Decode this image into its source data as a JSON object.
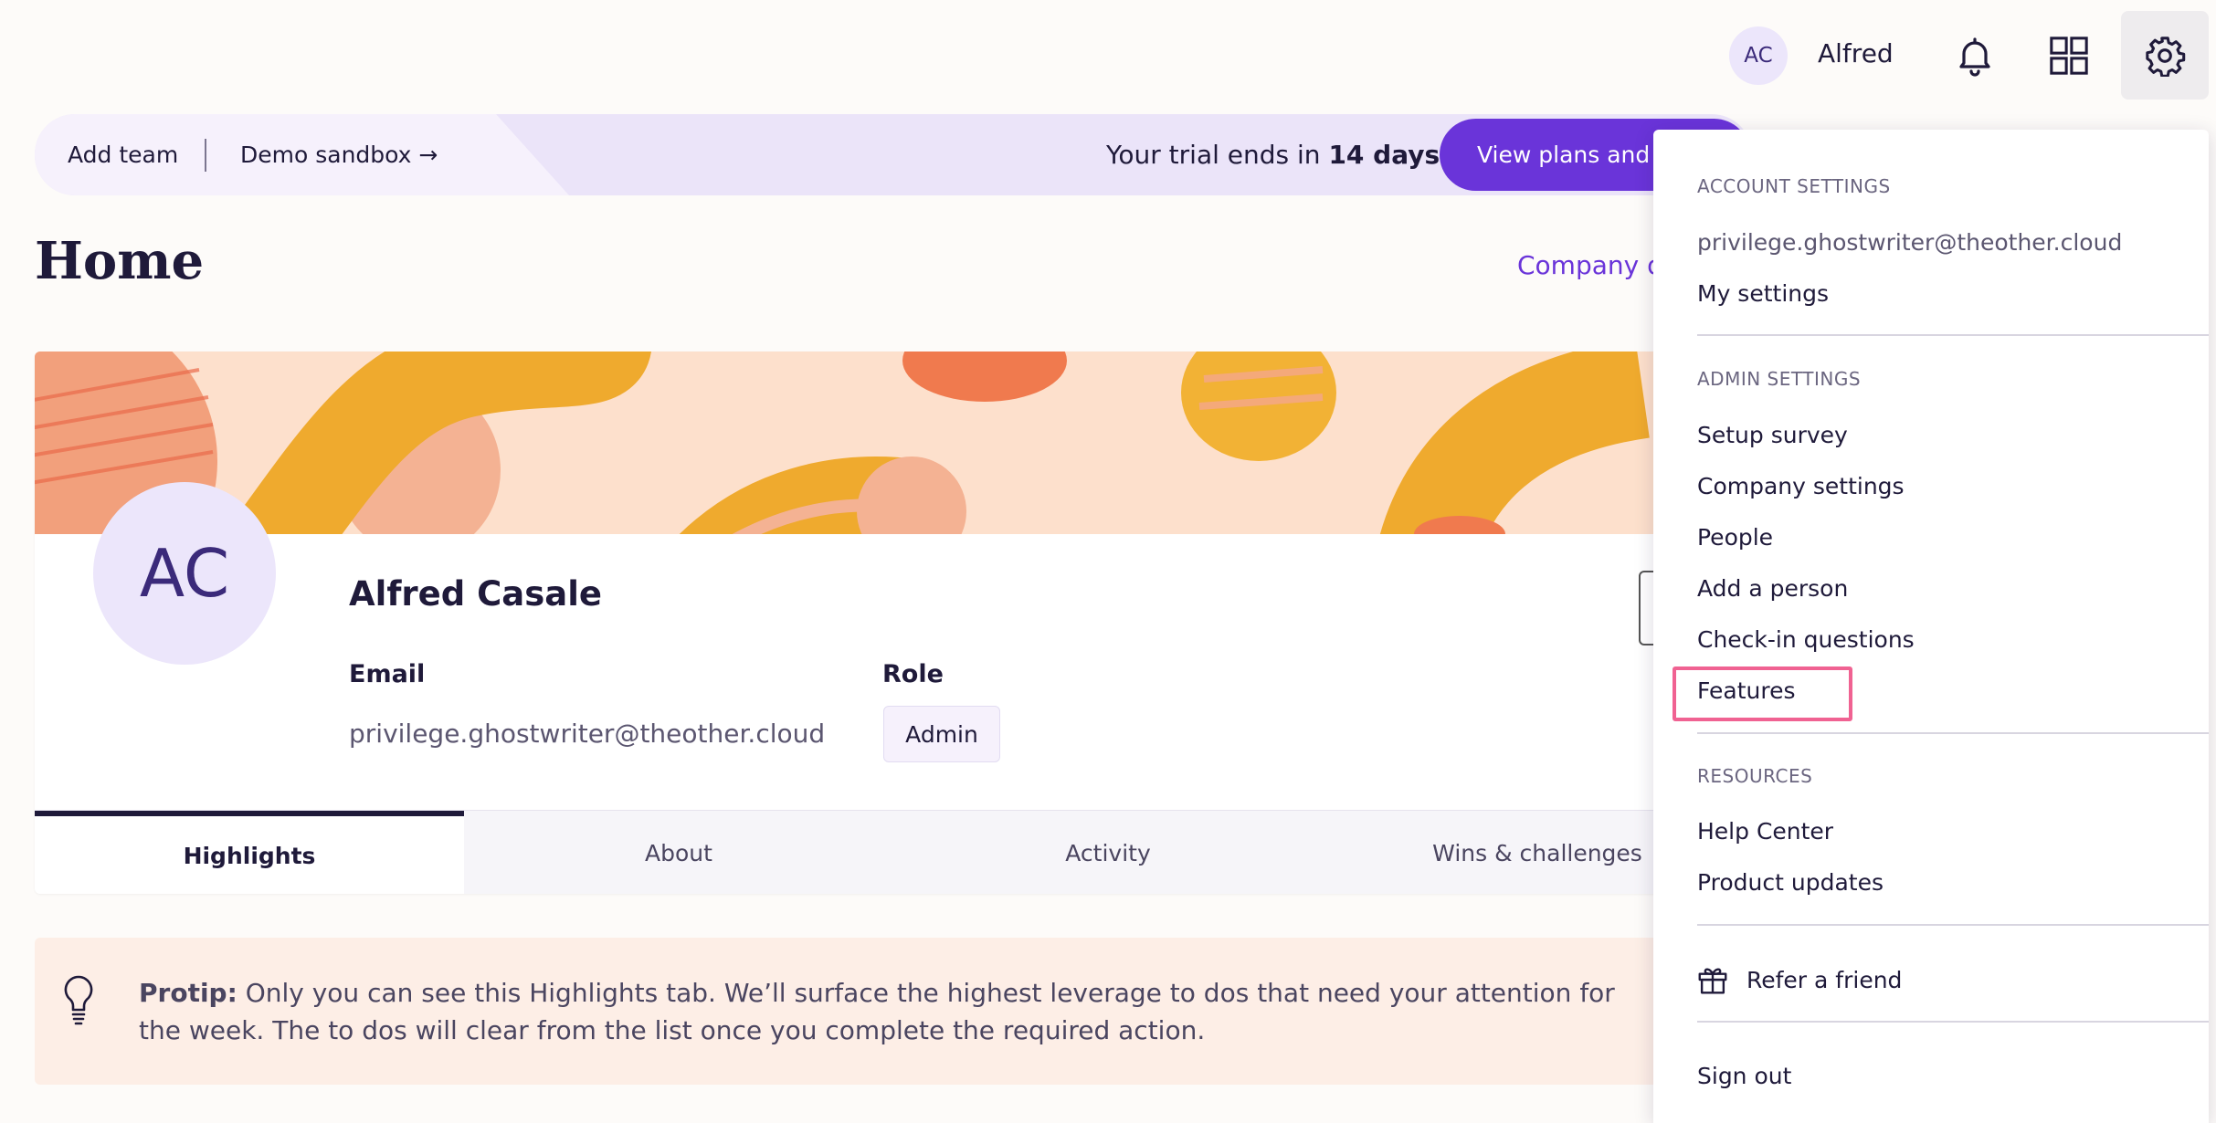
{
  "topnav": {
    "avatar_initials": "AC",
    "user_name": "Alfred",
    "icons": [
      "bell-icon",
      "grid-icon",
      "gear-icon"
    ]
  },
  "banner": {
    "add_team": "Add team",
    "demo_sandbox": "Demo sandbox →",
    "trial_prefix": "Your trial ends in ",
    "trial_days": "14 days.",
    "cta": "View plans and pricing"
  },
  "page": {
    "title": "Home",
    "company_link": "Company directory"
  },
  "profile": {
    "initials": "AC",
    "name": "Alfred Casale",
    "email_label": "Email",
    "email": "privilege.ghostwriter@theother.cloud",
    "role_label": "Role",
    "role": "Admin"
  },
  "tabs": [
    {
      "label": "Highlights",
      "active": true
    },
    {
      "label": "About"
    },
    {
      "label": "Activity"
    },
    {
      "label": "Wins & challenges"
    }
  ],
  "protip": {
    "label": "Protip:",
    "text": " Only you can see this Highlights tab. We’ll surface the highest leverage to dos that need your attention for the week. The to dos will clear from the list once you complete the required action."
  },
  "menu": {
    "account_heading": "ACCOUNT SETTINGS",
    "email": "privilege.ghostwriter@theother.cloud",
    "my_settings": "My settings",
    "admin_heading": "ADMIN SETTINGS",
    "admin_items": [
      "Setup survey",
      "Company settings",
      "People",
      "Add a person",
      "Check-in questions",
      "Features"
    ],
    "resources_heading": "RESOURCES",
    "resource_items": [
      "Help Center",
      "Product updates"
    ],
    "refer": "Refer a friend",
    "sign_out": "Sign out"
  },
  "colors": {
    "accent": "#6a34d9",
    "highlight": "#f06292",
    "banner_bg": "#ebe4f9",
    "protip_bg": "#fdeee6"
  }
}
